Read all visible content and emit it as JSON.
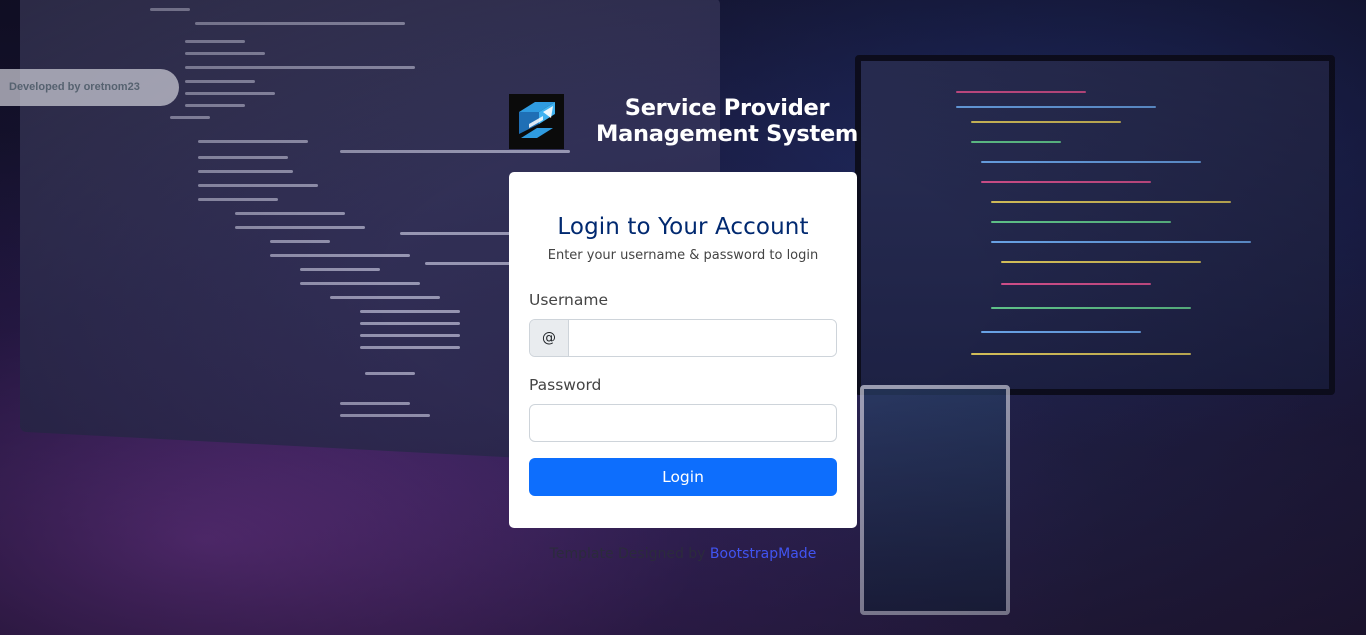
{
  "developer_tag": "Developed by oretnom23",
  "brand": {
    "title_line1": "Service Provider",
    "title_line2": "Management System",
    "logo_icon": "arrows-logo-icon"
  },
  "login": {
    "title": "Login to Your Account",
    "subtitle": "Enter your username & password to login",
    "username_label": "Username",
    "username_prefix": "@",
    "username_value": "",
    "password_label": "Password",
    "password_value": "",
    "button_label": "Login"
  },
  "credits": {
    "prefix": "Template Designed by ",
    "link_text": "BootstrapMade"
  },
  "colors": {
    "primary_button": "#0d6efd",
    "title": "#012970",
    "link": "#4154f1"
  }
}
